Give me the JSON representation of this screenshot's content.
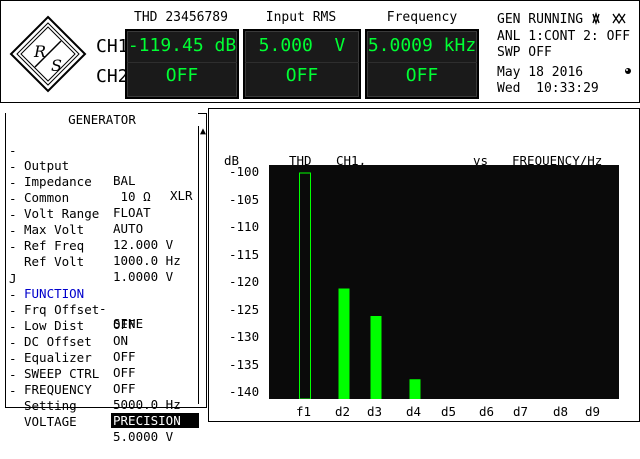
{
  "top": {
    "ch1_label": "CH1",
    "ch2_label": "CH2",
    "logo_text": "R&S",
    "displays": [
      {
        "title": "THD 23456789",
        "ch1": "-119.45 dB",
        "ch2": "OFF"
      },
      {
        "title": "Input RMS",
        "ch1": "5.000  V",
        "ch2": "OFF"
      },
      {
        "title": "Frequency",
        "ch1": "5.0009 kHz",
        "ch2": "OFF"
      }
    ],
    "status": {
      "line1": "GEN RUNNING",
      "line2": "ANL 1:CONT 2: OFF",
      "line3": "SWP OFF",
      "date": "May 18 2016",
      "time": "Wed  10:33:29"
    }
  },
  "generator": {
    "title": "GENERATOR",
    "rows": [
      {
        "dot": "-",
        "label": "Output",
        "value": "BAL",
        "value2": "XLR"
      },
      {
        "dot": "-",
        "label": "Impedance",
        "value": " 10 Ω",
        "value2": ""
      },
      {
        "dot": "-",
        "label": "Common",
        "value": "FLOAT",
        "value2": ""
      },
      {
        "dot": "-",
        "label": "Volt Range",
        "value": "AUTO",
        "value2": ""
      },
      {
        "dot": "-",
        "label": "Max Volt",
        "value": "12.000 V",
        "value2": ""
      },
      {
        "dot": "-",
        "label": "Ref Freq",
        "value": "1000.0 Hz",
        "value2": ""
      },
      {
        "dot": "-",
        "label": "Ref Volt",
        "value": "1.0000 V",
        "value2": ""
      }
    ],
    "function": {
      "dot": "J",
      "label": "FUNCTION",
      "dash": "-",
      "value": "SINE"
    },
    "rows2": [
      {
        "dot": "-",
        "label": "Frq Offset",
        "value": "OFF"
      },
      {
        "dot": "-",
        "label": "Low Dist",
        "value": "ON"
      },
      {
        "dot": "-",
        "label": "DC Offset",
        "value": "OFF"
      },
      {
        "dot": "-",
        "label": "Equalizer",
        "value": "OFF"
      },
      {
        "dot": "-",
        "label": "SWEEP CTRL",
        "value": "OFF"
      },
      {
        "dot": "-",
        "label": "FREQUENCY",
        "value": "5000.0 Hz"
      },
      {
        "dot": "-",
        "label": "Setting",
        "value": "PRECISION"
      },
      {
        "dot": "-",
        "label": "VOLTAGE",
        "value": "5.0000 V"
      }
    ]
  },
  "graph": {
    "unit": "dB",
    "title_left": "THD",
    "title_ch": "CH1,",
    "title_vs": "vs",
    "title_right": "FREQUENCY/Hz",
    "colors": {
      "bar": "#00ff00",
      "plot_bg": "#0a0a0a"
    }
  },
  "chart_data": {
    "type": "bar",
    "categories": [
      "f1",
      "d2",
      "d3",
      "d4",
      "d5",
      "d6",
      "d7",
      "d8",
      "d9"
    ],
    "values": [
      -100,
      -121,
      -126,
      -137.5,
      null,
      null,
      null,
      null,
      null
    ],
    "fundamental_outline": true,
    "ylabel": "dB",
    "ylim": [
      -140,
      -100
    ],
    "yticks": [
      "-100",
      "-105",
      "-110",
      "-115",
      "-120",
      "-125",
      "-130",
      "-135",
      "-140"
    ]
  }
}
